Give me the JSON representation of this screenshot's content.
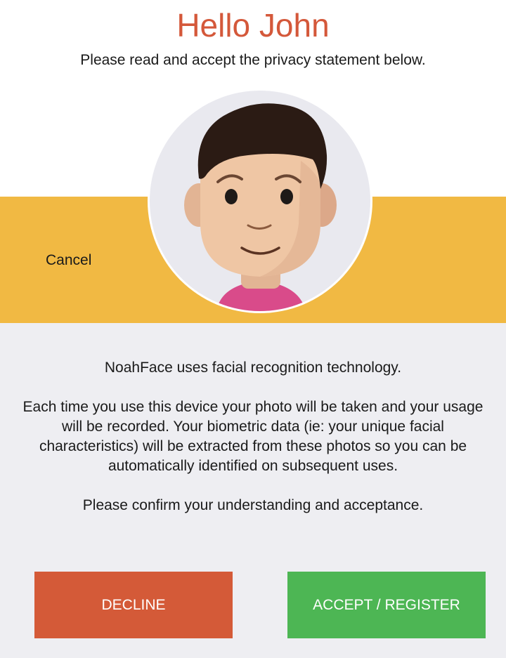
{
  "header": {
    "greeting": "Hello John",
    "subtitle": "Please read and accept the privacy statement below."
  },
  "band": {
    "cancel_label": "Cancel"
  },
  "avatar": {
    "icon": "face-avatar-icon"
  },
  "statement": {
    "line1": "NoahFace uses facial recognition technology.",
    "line2": "Each time you use this device your photo will be taken and your usage will be recorded. Your biometric data (ie: your unique facial characteristics) will be extracted from these photos so you can be automatically identified on subsequent uses.",
    "line3": "Please confirm your understanding and acceptance."
  },
  "actions": {
    "decline_label": "DECLINE",
    "accept_label": "ACCEPT / REGISTER"
  },
  "colors": {
    "accent": "#d4583a",
    "band": "#f1b943",
    "decline": "#d45a38",
    "accept": "#4db654",
    "background": "#eeeef2"
  }
}
